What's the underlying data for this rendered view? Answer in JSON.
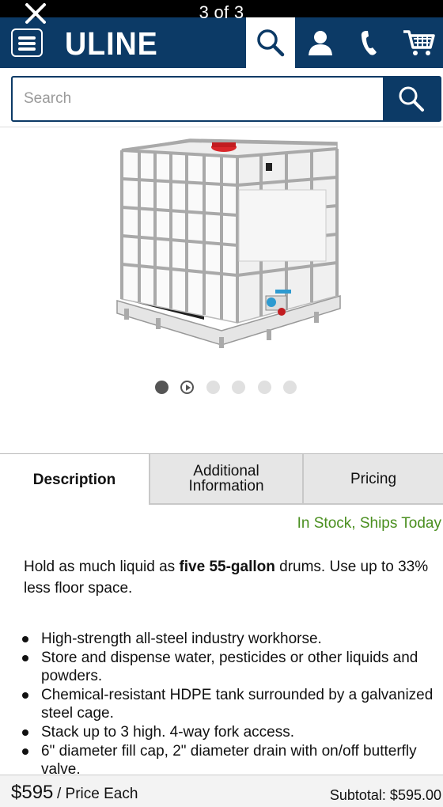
{
  "overlay": {
    "gallery_count": "3 of 3"
  },
  "header": {
    "logo": "ULINE",
    "icons": [
      "menu-icon",
      "search-icon",
      "account-icon",
      "phone-icon",
      "cart-icon"
    ],
    "brand_color": "#0c3a66"
  },
  "search": {
    "placeholder": "Search",
    "value": ""
  },
  "carousel": {
    "dots": 6,
    "active_index": 0,
    "video_index": 1
  },
  "tabs": {
    "description": "Description",
    "additional_line1": "Additional",
    "additional_line2": "Information",
    "pricing": "Pricing"
  },
  "stock_status": {
    "text": "In Stock, Ships Today",
    "color": "#4a8f1f"
  },
  "description": {
    "before": "Hold as much liquid as ",
    "bold": "five 55-gallon",
    "after": " drums. Use up to 33% less floor space."
  },
  "features": [
    "High-strength all-steel industry workhorse.",
    "Store and dispense water, pesticides or other liquids and powders.",
    "Chemical-resistant HDPE tank surrounded by a galvanized steel cage.",
    "Stack up to 3 high. 4-way fork access.",
    "6\" diameter fill cap, 2\" diameter drain with on/off butterfly valve."
  ],
  "footer": {
    "price": "$595",
    "price_unit": "/ Price Each",
    "subtotal": "Subtotal: $595.00"
  }
}
